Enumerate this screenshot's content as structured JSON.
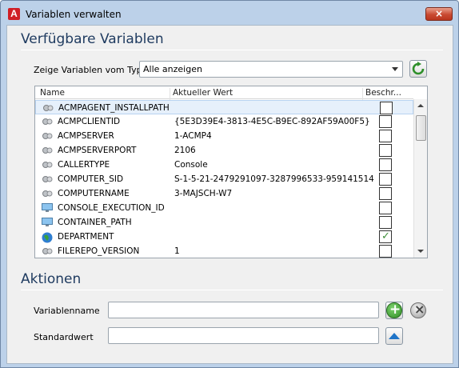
{
  "window": {
    "title": "Variablen verwalten",
    "close_label": "×",
    "app_icon_glyph": "A"
  },
  "available": {
    "section_title": "Verfügbare Variablen",
    "filter_label": "Zeige Variablen vom Typ",
    "filter_value": "Alle anzeigen"
  },
  "grid": {
    "columns": [
      "Name",
      "Aktueller Wert",
      "Beschr..."
    ],
    "rows": [
      {
        "name": "ACMPAGENT_INSTALLPATH",
        "value": "",
        "icon": "gear-pair-icon",
        "checked": false,
        "selected": true
      },
      {
        "name": "ACMPCLIENTID",
        "value": "{5E3D39E4-3813-4E5C-B9EC-892AF59A00F5}",
        "icon": "gear-pair-icon",
        "checked": false
      },
      {
        "name": "ACMPSERVER",
        "value": "1-ACMP4",
        "icon": "gear-pair-icon",
        "checked": false
      },
      {
        "name": "ACMPSERVERPORT",
        "value": "2106",
        "icon": "gear-pair-icon",
        "checked": false
      },
      {
        "name": "CALLERTYPE",
        "value": "Console",
        "icon": "gear-pair-icon",
        "checked": false
      },
      {
        "name": "COMPUTER_SID",
        "value": "S-1-5-21-2479291097-3287996533-959141514",
        "icon": "gear-pair-icon",
        "checked": false
      },
      {
        "name": "COMPUTERNAME",
        "value": "3-MAJSCH-W7",
        "icon": "gear-pair-icon",
        "checked": false
      },
      {
        "name": "CONSOLE_EXECUTION_ID",
        "value": "",
        "icon": "monitor-icon",
        "checked": false
      },
      {
        "name": "CONTAINER_PATH",
        "value": "",
        "icon": "monitor-icon",
        "checked": false
      },
      {
        "name": "DEPARTMENT",
        "value": "",
        "icon": "globe-icon",
        "checked": true
      },
      {
        "name": "FILEREPO_VERSION",
        "value": "1",
        "icon": "gear-pair-icon",
        "checked": false
      }
    ]
  },
  "actions": {
    "section_title": "Aktionen",
    "variable_name_label": "Variablenname",
    "variable_name_value": "",
    "default_value_label": "Standardwert",
    "default_value_value": ""
  },
  "colors": {
    "title_frame": "#bcd1e9",
    "section_title": "#1e3a5f",
    "selected_row": "#e6f0fb",
    "check_green": "#3f8f3a",
    "close_red": "#c94a32"
  }
}
